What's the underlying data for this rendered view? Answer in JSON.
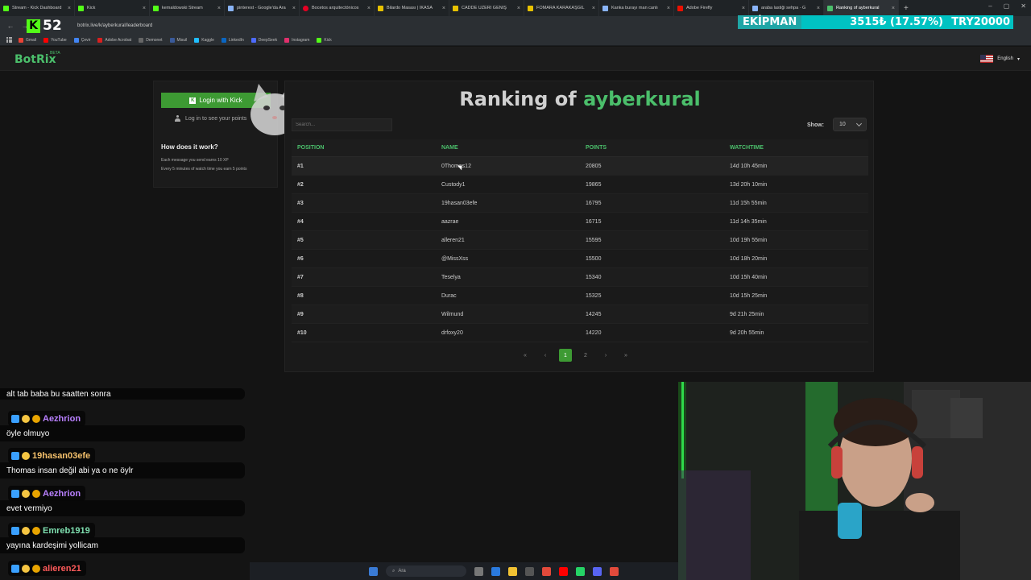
{
  "browser": {
    "tabs": [
      {
        "label": "Stream - Kick Dashboard",
        "color": "#53fc18"
      },
      {
        "label": "Kick",
        "color": "#53fc18"
      },
      {
        "label": "kemaldowski Stream",
        "color": "#53fc18"
      },
      {
        "label": "pinterest - Google'da Ara",
        "color": "#8ab4f8"
      },
      {
        "label": "Bocetos arquitectónicos",
        "color": "#e60023"
      },
      {
        "label": "Bilardo Masası | İKASA",
        "color": "#e8c200"
      },
      {
        "label": "CADDE ÜZERİ GENİŞ",
        "color": "#e8c200"
      },
      {
        "label": "FOMARA KARAKAŞGİL",
        "color": "#e8c200"
      },
      {
        "label": "Kanka burayı man canlı",
        "color": "#8ab4f8"
      },
      {
        "label": "Adobe Firefly",
        "color": "#eb1000"
      },
      {
        "label": "araba lastiği sehpa - G",
        "color": "#8ab4f8"
      },
      {
        "label": "Ranking of ayberkural",
        "color": "#4bbf6b"
      }
    ],
    "url": "botrix.live/k/ayberkural/leaderboard",
    "bookmarks": [
      "Gmail",
      "YouTube",
      "Çevir",
      "Adobe Acrobat",
      "Demonet",
      "Misuil",
      "Kaggle",
      "LinkedIn",
      "DeepSeek",
      "Instagram",
      "Kick"
    ]
  },
  "overlay": {
    "counter": "52",
    "ticker_label": "EKİPMAN",
    "ticker_value": "3515₺ (17.57%)",
    "ticker_goal": "TRY20000"
  },
  "site": {
    "logo": "BotRix",
    "beta": "BETA",
    "language": "English"
  },
  "sidebar": {
    "login_button": "Login with Kick",
    "login_hint": "Log in to see your points",
    "how_title": "How does it work?",
    "how_line1": "Each message you send earns 10 XP",
    "how_line2": "Every 5 minutes of watch time you earn 5 points"
  },
  "ranking": {
    "title_prefix": "Ranking of",
    "username": "ayberkural",
    "search_placeholder": "Search...",
    "show_label": "Show:",
    "show_value": "10",
    "columns": [
      "POSITION",
      "NAME",
      "POINTS",
      "WATCHTIME"
    ],
    "rows": [
      [
        "#1",
        "0Thomas12",
        "20805",
        "14d 10h 45min"
      ],
      [
        "#2",
        "Custody1",
        "19865",
        "13d 20h 10min"
      ],
      [
        "#3",
        "19hasan03efe",
        "16795",
        "11d 15h 55min"
      ],
      [
        "#4",
        "aazrae",
        "16715",
        "11d 14h 35min"
      ],
      [
        "#5",
        "alleren21",
        "15595",
        "10d 19h 55min"
      ],
      [
        "#6",
        "@MissXss",
        "15500",
        "10d 18h 20min"
      ],
      [
        "#7",
        "Teselya",
        "15340",
        "10d 15h 40min"
      ],
      [
        "#8",
        "Durac",
        "15325",
        "10d 15h 25min"
      ],
      [
        "#9",
        "Wilmund",
        "14245",
        "9d 21h 25min"
      ],
      [
        "#10",
        "drfoxy20",
        "14220",
        "9d 20h 55min"
      ]
    ],
    "pager": {
      "first": "«",
      "prev": "‹",
      "page1": "1",
      "page2": "2",
      "next": "›",
      "last": "»"
    }
  },
  "chat": {
    "top_message": "alt tab baba bu saatten sonra",
    "messages": [
      {
        "user": "Aezhrion",
        "color": "#b980ff",
        "text": "öyle olmuyo"
      },
      {
        "user": "19hasan03efe",
        "color": "#f5c16c",
        "text": "Thomas insan değil abi ya o ne öylr"
      },
      {
        "user": "Aezhrion",
        "color": "#b980ff",
        "text": "evet vermiyo"
      },
      {
        "user": "Emreb1919",
        "color": "#7fe0b0",
        "text": "yayına kardeşimi yollicam"
      },
      {
        "user": "alieren21",
        "color": "#ff5a5a",
        "text": ""
      }
    ]
  },
  "taskbar": {
    "search": "Ara"
  }
}
